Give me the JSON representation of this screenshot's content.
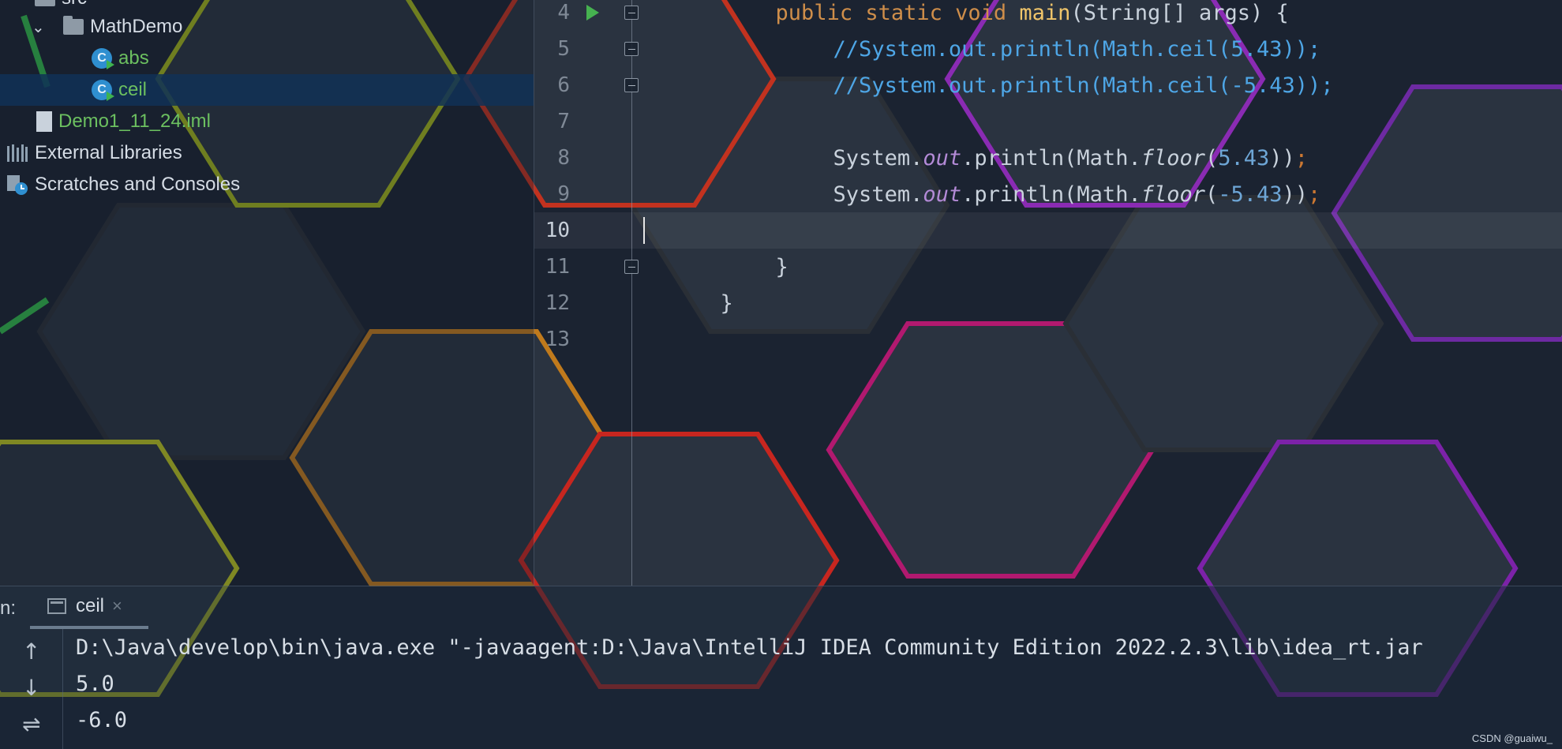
{
  "project_tree": {
    "items": [
      {
        "label": "src"
      },
      {
        "label": "MathDemo"
      },
      {
        "label": "abs"
      },
      {
        "label": "ceil"
      },
      {
        "label": "Demo1_11_24.iml"
      },
      {
        "label": "External Libraries"
      },
      {
        "label": "Scratches and Consoles"
      }
    ],
    "selected": "ceil"
  },
  "editor": {
    "lines": [
      {
        "num": "4",
        "tokens": [
          [
            "kw",
            "public static void "
          ],
          [
            "fn",
            "main"
          ],
          [
            "plain",
            "(String[] args) {"
          ]
        ]
      },
      {
        "num": "5",
        "tokens": [
          [
            "cmt",
            "//System.out.println(Math.ceil(5.43));"
          ]
        ]
      },
      {
        "num": "6",
        "tokens": [
          [
            "cmt",
            "//System.out.println(Math.ceil(-5.43));"
          ]
        ]
      },
      {
        "num": "7",
        "tokens": []
      },
      {
        "num": "8",
        "tokens": [
          [
            "plain",
            "System."
          ],
          [
            "italic-purple",
            "out"
          ],
          [
            "plain",
            ".println(Math."
          ],
          [
            "italic",
            "floor"
          ],
          [
            "plain",
            "("
          ],
          [
            "num",
            "5.43"
          ],
          [
            "plain",
            "))"
          ],
          [
            "semi",
            ";"
          ]
        ]
      },
      {
        "num": "9",
        "tokens": [
          [
            "plain",
            "System."
          ],
          [
            "italic-purple",
            "out"
          ],
          [
            "plain",
            ".println(Math."
          ],
          [
            "italic",
            "floor"
          ],
          [
            "plain",
            "("
          ],
          [
            "num",
            "-5.43"
          ],
          [
            "plain",
            "))"
          ],
          [
            "semi",
            ";"
          ]
        ]
      },
      {
        "num": "10",
        "tokens": []
      },
      {
        "num": "11",
        "tokens": [
          [
            "plain",
            "}"
          ]
        ]
      },
      {
        "num": "12",
        "tokens": [
          [
            "plain",
            "}"
          ]
        ]
      },
      {
        "num": "13",
        "tokens": []
      }
    ],
    "current_line": "10"
  },
  "run_panel": {
    "label": "n:",
    "tab_label": "ceil",
    "close_glyph": "×",
    "tools": [
      "up-arrow-icon",
      "down-arrow-icon",
      "soft-wrap-icon"
    ],
    "output": [
      "D:\\Java\\develop\\bin\\java.exe \"-javaagent:D:\\Java\\IntelliJ IDEA Community Edition 2022.2.3\\lib\\idea_rt.jar",
      "5.0",
      "-6.0"
    ]
  },
  "watermark": "CSDN @guaiwu_",
  "colors": {
    "keyword": "#cf8e4a",
    "method": "#f0c56a",
    "comment": "#4ea6e6",
    "field": "#b38ad6",
    "number": "#6ea6d6",
    "selection": "#113156"
  }
}
